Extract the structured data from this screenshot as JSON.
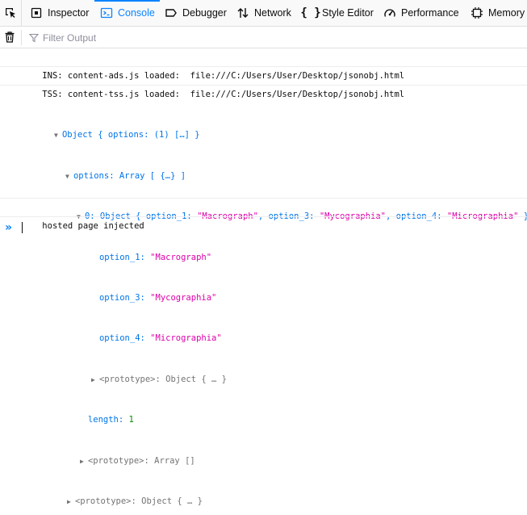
{
  "tabs": [
    {
      "label": "Inspector",
      "icon": "inspector-icon"
    },
    {
      "label": "Console",
      "icon": "console-icon",
      "selected": true
    },
    {
      "label": "Debugger",
      "icon": "debugger-icon"
    },
    {
      "label": "Network",
      "icon": "network-icon"
    },
    {
      "label": "Style Editor",
      "icon": "style-editor-icon"
    },
    {
      "label": "Performance",
      "icon": "performance-icon"
    },
    {
      "label": "Memory",
      "icon": "memory-icon"
    }
  ],
  "filter": {
    "placeholder": "Filter Output",
    "value": ""
  },
  "messages": {
    "line1": "INS: content-ads.js loaded:  file:///C:/Users/User/Desktop/jsonobj.html",
    "line2": "TSS: content-tss.js loaded:  file:///C:/Users/User/Desktop/jsonobj.html",
    "object": {
      "root_text": "Object { options: (1) […] }",
      "options_key": "options",
      "options_value": "Array [ {…} ]",
      "item_key": "0",
      "item_prefix": "Object { ",
      "item_suffix": " }",
      "preview": [
        {
          "key": "option_1",
          "value": "\"Macrograph\""
        },
        {
          "key": "option_3",
          "value": "\"Mycographia\""
        },
        {
          "key": "option_4",
          "value": "\"Micrographia\""
        }
      ],
      "props": [
        {
          "key": "option_1",
          "value": "\"Macrograph\""
        },
        {
          "key": "option_3",
          "value": "\"Mycographia\""
        },
        {
          "key": "option_4",
          "value": "\"Micrographia\""
        }
      ],
      "inner_proto_key": "<prototype>",
      "inner_proto_value": "Object { … }",
      "length_key": "length",
      "length_value": "1",
      "array_proto_key": "<prototype>",
      "array_proto_value": "Array []",
      "root_proto_key": "<prototype>",
      "root_proto_value": "Object { … }"
    },
    "line3": "hosted page injected"
  },
  "input": {
    "prompt": "»"
  },
  "colors": {
    "accent": "#0a84ff",
    "key_blue": "#0074e8",
    "string_magenta": "#dd00a9",
    "number_green": "#058b00"
  }
}
